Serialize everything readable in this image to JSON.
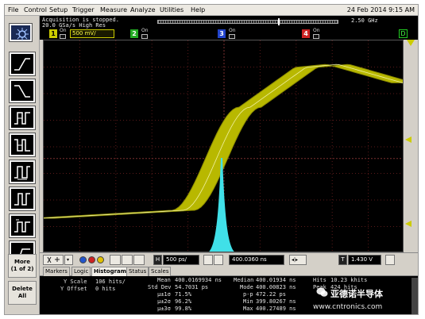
{
  "menu": {
    "items": [
      "File",
      "Control",
      "Setup",
      "Trigger",
      "Measure",
      "Analyze",
      "Utilities",
      "Help"
    ],
    "datetime": "24 Feb 2014  9:15 AM"
  },
  "status": {
    "line1": "Acquisition is stopped.",
    "line2": "20.0 GSa/s   High Res",
    "bandwidth": "2.50 GHz"
  },
  "channels": {
    "ch1": {
      "number": "1",
      "on": "On",
      "scale": "500 mV/"
    },
    "ch2": {
      "number": "2",
      "on": "On"
    },
    "ch3": {
      "number": "3",
      "on": "On"
    },
    "ch4": {
      "number": "4",
      "on": "On"
    },
    "digital": "D"
  },
  "sidebar": {
    "more_label": "More\n(1 of 2)",
    "delete_label": "Delete\nAll",
    "tool_icons": [
      "rising-edge-icon",
      "falling-edge-icon",
      "pulse-width-icon",
      "negative-pulse-icon",
      "period-icon",
      "duty-cycle-icon",
      "pulse-count-icon",
      "rise-time-icon"
    ]
  },
  "controls": {
    "horizontal_label": "H",
    "timebase": "500 ps/",
    "position": "400.0360 ns",
    "trigger_label": "T",
    "trigger_level": "1.430 V",
    "colors": {
      "blue": "#2255cc",
      "red": "#cc2222",
      "yellow": "#e0c000"
    }
  },
  "tabs": [
    "Markers",
    "Logic",
    "Histogram",
    "Status",
    "Scales"
  ],
  "active_tab": "Histogram",
  "stats": {
    "y_scale_label": "Y Scale",
    "y_scale_value": "106 hits/",
    "y_offset_label": "Y Offset",
    "y_offset_value": "0 hits",
    "mean_label": "Mean",
    "mean_value": "400.0169934 ns",
    "median_label": "Median",
    "median_value": "400.01934 ns",
    "hits_label": "Hits",
    "hits_value": "10.23 khits",
    "stddev_label": "Std Dev",
    "stddev_value": "54.7031 ps",
    "mode_label": "Mode",
    "mode_value": "400.00823 ns",
    "peak_label": "Peak",
    "peak_value": "424 hits",
    "s1_label": "µ±1σ",
    "s1_value": "71.5%",
    "pp_label": "p-p",
    "pp_value": "472.22 ps",
    "s2_label": "µ±2σ",
    "s2_value": "96.2%",
    "min_label": "Min",
    "min_value": "399.80267 ns",
    "s3_label": "µ±3σ",
    "s3_value": "99.8%",
    "max_label": "Max",
    "max_value": "400.27489 ns"
  },
  "watermark": {
    "brand": "亚德诺半导体",
    "url": "www.cntronics.com"
  },
  "display_colors": {
    "background": "#000000",
    "waveform": "#b8b800",
    "histogram": "#40e0e8",
    "grid": "#5a1a1a"
  }
}
